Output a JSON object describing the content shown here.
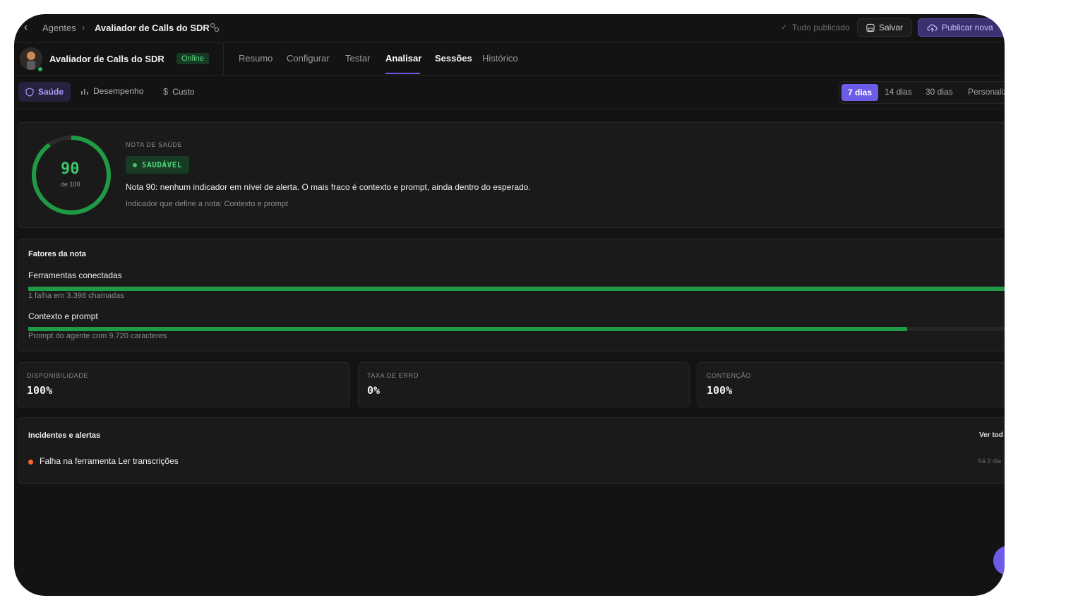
{
  "breadcrumb": {
    "parent": "Agentes",
    "current": "Avaliador de Calls do SDR"
  },
  "topbar": {
    "status": "Tudo publicado",
    "save_label": "Salvar",
    "publish_label": "Publicar nova"
  },
  "agent": {
    "name": "Avaliador de Calls do SDR",
    "status_badge": "Online"
  },
  "tabs": [
    "Resumo",
    "Configurar",
    "Testar",
    "Analisar",
    "Sessões",
    "Histórico"
  ],
  "active_tab": "Analisar",
  "subtabs": [
    "Saúde",
    "Desempenho",
    "Custo"
  ],
  "ranges": [
    "7 dias",
    "14 dias",
    "30 dias",
    "Personaliz"
  ],
  "health": {
    "score": "90",
    "score_value": 90,
    "out_of": "de 100",
    "section_label": "NOTA DE SAÚDE",
    "badge": "SAUDÁVEL",
    "summary": "Nota 90: nenhum indicador em nível de alerta. O mais fraco é contexto e prompt, ainda dentro do esperado.",
    "defining": "Indicador que define a nota: Contexto e prompt"
  },
  "factors": {
    "title": "Fatores da nota",
    "items": [
      {
        "name": "Ferramentas conectadas",
        "detail": "1 falha em 3.398 chamadas",
        "level": 1.0
      },
      {
        "name": "Contexto e prompt",
        "detail": "Prompt do agente com 9.720 caracteres",
        "level": 0.9
      }
    ]
  },
  "metrics": [
    {
      "label": "DISPONIBILIDADE",
      "value": "100%"
    },
    {
      "label": "TAXA DE ERRO",
      "value": "0%"
    },
    {
      "label": "CONTENÇÃO",
      "value": "100%"
    }
  ],
  "incidents": {
    "title": "Incidentes e alertas",
    "see_all": "Ver tod",
    "items": [
      {
        "text": "Falha na ferramenta Ler transcrições",
        "time": "há 2 dia"
      }
    ]
  },
  "colors": {
    "accent": "#6d5ce8",
    "healthy": "#1f9a45",
    "alert": "#ff6a2b"
  }
}
